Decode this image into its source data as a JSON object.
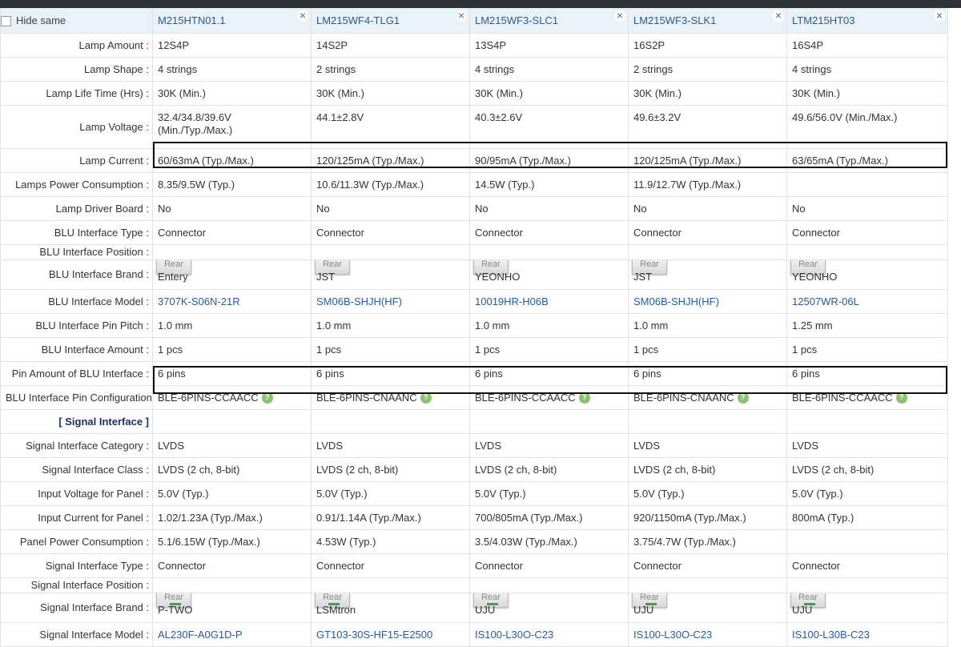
{
  "header": {
    "hide_same_label": "Hide same",
    "models": [
      "M215HTN01.1",
      "LM215WF4-TLG1",
      "LM215WF3-SLC1",
      "LM215WF3-SLK1",
      "LTM215HT03"
    ],
    "close_glyph": "×"
  },
  "rear_label": "Rear",
  "rows_top": [
    {
      "label": "Lamp Amount :",
      "values": [
        "12S4P",
        "14S2P",
        "13S4P",
        "16S2P",
        "16S4P"
      ]
    },
    {
      "label": "Lamp Shape :",
      "values": [
        "4 strings",
        "2 strings",
        "4 strings",
        "2 strings",
        "4 strings"
      ]
    },
    {
      "label": "Lamp Life Time (Hrs) :",
      "values": [
        "30K (Min.)",
        "30K (Min.)",
        "30K (Min.)",
        "30K (Min.)",
        "30K (Min.)"
      ]
    }
  ],
  "lamp_voltage": {
    "label": "Lamp Voltage :",
    "values": [
      "32.4/34.8/39.6V",
      "44.1±2.8V",
      "40.3±2.6V",
      "49.6±3.2V",
      "49.6/56.0V (Min./Max.)"
    ],
    "value1_line2": "(Min./Typ./Max.)"
  },
  "rows_mid": [
    {
      "label": "Lamp Current :",
      "values": [
        "60/63mA (Typ./Max.)",
        "120/125mA (Typ./Max.)",
        "90/95mA (Typ./Max.)",
        "120/125mA (Typ./Max.)",
        "63/65mA (Typ./Max.)"
      ]
    },
    {
      "label": "Lamps Power Consumption :",
      "values": [
        "8.35/9.5W (Typ.)",
        "10.6/11.3W (Typ./Max.)",
        "14.5W (Typ.)",
        "11.9/12.7W (Typ./Max.)",
        ""
      ]
    },
    {
      "label": "Lamp Driver Board :",
      "values": [
        "No",
        "No",
        "No",
        "No",
        "No"
      ]
    },
    {
      "label": "BLU Interface Type :",
      "values": [
        "Connector",
        "Connector",
        "Connector",
        "Connector",
        "Connector"
      ]
    }
  ],
  "blu_position_label": "BLU Interface Position :",
  "blu_brand": {
    "label": "BLU Interface Brand :",
    "values": [
      "Entery",
      "JST",
      "YEONHO",
      "JST",
      "YEONHO"
    ]
  },
  "blu_model": {
    "label": "BLU Interface Model :",
    "values": [
      "3707K-S06N-21R",
      "SM06B-SHJH(HF)",
      "10019HR-H06B",
      "SM06B-SHJH(HF)",
      "12507WR-06L"
    ]
  },
  "rows_blu": [
    {
      "label": "BLU Interface Pin Pitch :",
      "values": [
        "1.0 mm",
        "1.0 mm",
        "1.0 mm",
        "1.0 mm",
        "1.25 mm"
      ]
    },
    {
      "label": "BLU Interface Amount :",
      "values": [
        "1 pcs",
        "1 pcs",
        "1 pcs",
        "1 pcs",
        "1 pcs"
      ]
    },
    {
      "label": "Pin Amount of BLU Interface :",
      "values": [
        "6 pins",
        "6 pins",
        "6 pins",
        "6 pins",
        "6 pins"
      ]
    }
  ],
  "blu_pin_config": {
    "label": "BLU Interface Pin Configuration :",
    "values": [
      "BLE-6PINS-CCAACC",
      "BLE-6PINS-CNAANC",
      "BLE-6PINS-CCAACC",
      "BLE-6PINS-CNAANC",
      "BLE-6PINS-CCAACC"
    ],
    "help_glyph": "?"
  },
  "signal_section_label": "[ Signal Interface ]",
  "rows_signal": [
    {
      "label": "Signal Interface Category :",
      "values": [
        "LVDS",
        "LVDS",
        "LVDS",
        "LVDS",
        "LVDS"
      ]
    },
    {
      "label": "Signal Interface Class :",
      "values": [
        "LVDS (2 ch, 8-bit)",
        "LVDS (2 ch, 8-bit)",
        "LVDS (2 ch, 8-bit)",
        "LVDS (2 ch, 8-bit)",
        "LVDS (2 ch, 8-bit)"
      ]
    },
    {
      "label": "Input Voltage for Panel :",
      "values": [
        "5.0V (Typ.)",
        "5.0V (Typ.)",
        "5.0V (Typ.)",
        "5.0V (Typ.)",
        "5.0V (Typ.)"
      ]
    },
    {
      "label": "Input Current for Panel :",
      "values": [
        "1.02/1.23A (Typ./Max.)",
        "0.91/1.14A (Typ./Max.)",
        "700/805mA (Typ./Max.)",
        "920/1150mA (Typ./Max.)",
        "800mA (Typ.)"
      ]
    },
    {
      "label": "Panel Power Consumption :",
      "values": [
        "5.1/6.15W (Typ./Max.)",
        "4.53W (Typ.)",
        "3.5/4.03W (Typ./Max.)",
        "3.75/4.7W (Typ./Max.)",
        ""
      ]
    },
    {
      "label": "Signal Interface Type :",
      "values": [
        "Connector",
        "Connector",
        "Connector",
        "Connector",
        "Connector"
      ]
    }
  ],
  "signal_position_label": "Signal Interface Position :",
  "signal_brand": {
    "label": "Signal Interface Brand :",
    "values": [
      "P-TWO",
      "LSMtron",
      "UJU",
      "UJU",
      "UJU"
    ]
  },
  "signal_model": {
    "label": "Signal Interface Model :",
    "values": [
      "AL230F-A0G1D-P",
      "GT103-30S-HF15-E2500",
      "IS100-L30O-C23",
      "IS100-L30O-C23",
      "IS100-L30B-C23"
    ]
  }
}
